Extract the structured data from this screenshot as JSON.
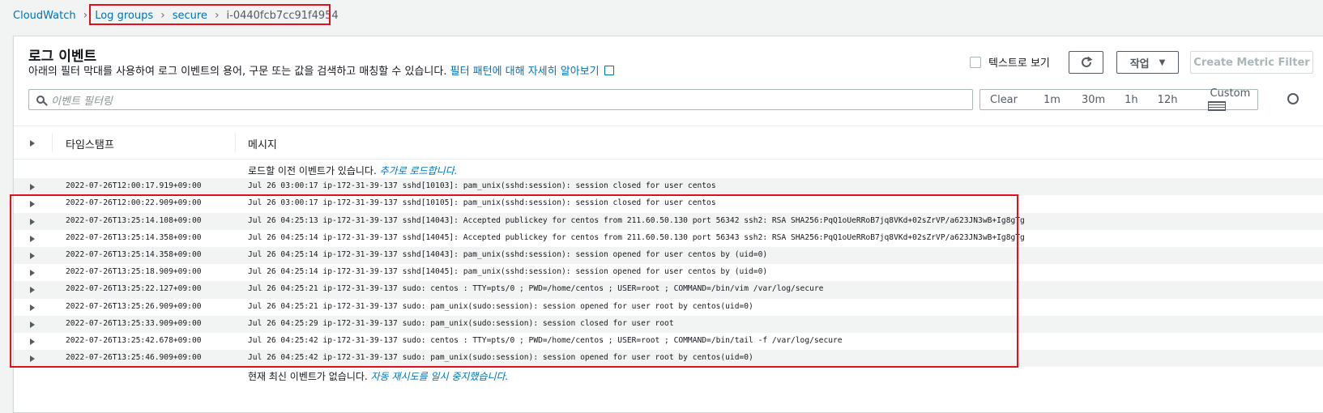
{
  "breadcrumb": {
    "root": "CloudWatch",
    "log_groups": "Log groups",
    "group": "secure",
    "stream": "i-0440fcb7cc91f4954"
  },
  "header": {
    "title": "로그 이벤트",
    "description": "아래의 필터 막대를 사용하여 로그 이벤트의 용어, 구문 또는 값을 검색하고 매칭할 수 있습니다.",
    "learn_more": "필터 패턴에 대해 자세히 알아보기",
    "text_view_label": "텍스트로 보기",
    "action_label": "작업",
    "create_metric_filter": "Create Metric Filter"
  },
  "search": {
    "placeholder": "이벤트 필터링"
  },
  "time_range": {
    "clear": "Clear",
    "m1": "1m",
    "m30": "30m",
    "h1": "1h",
    "h12": "12h",
    "custom": "Custom"
  },
  "table": {
    "col_timestamp": "타임스탬프",
    "col_message": "메시지",
    "load_earlier_text": "로드할 이전 이벤트가 있습니다.",
    "load_more_link": "추가로 로드합니다.",
    "no_newer_text": "현재 최신 이벤트가 없습니다.",
    "auto_retry_link": "자동 재시도를 일시 중지했습니다.",
    "rows": [
      {
        "ts": "2022-07-26T12:00:17.919+09:00",
        "msg": "Jul 26 03:00:17 ip-172-31-39-137 sshd[10103]: pam_unix(sshd:session): session closed for user centos"
      },
      {
        "ts": "2022-07-26T12:00:22.909+09:00",
        "msg": "Jul 26 03:00:17 ip-172-31-39-137 sshd[10105]: pam_unix(sshd:session): session closed for user centos"
      },
      {
        "ts": "2022-07-26T13:25:14.108+09:00",
        "msg": "Jul 26 04:25:13 ip-172-31-39-137 sshd[14043]: Accepted publickey for centos from 211.60.50.130 port 56342 ssh2: RSA SHA256:PqQ1oUeRRoB7jq8VKd+02sZrVP/a623JN3wB+Ig8gTg"
      },
      {
        "ts": "2022-07-26T13:25:14.358+09:00",
        "msg": "Jul 26 04:25:14 ip-172-31-39-137 sshd[14045]: Accepted publickey for centos from 211.60.50.130 port 56343 ssh2: RSA SHA256:PqQ1oUeRRoB7jq8VKd+02sZrVP/a623JN3wB+Ig8gTg"
      },
      {
        "ts": "2022-07-26T13:25:14.358+09:00",
        "msg": "Jul 26 04:25:14 ip-172-31-39-137 sshd[14043]: pam_unix(sshd:session): session opened for user centos by (uid=0)"
      },
      {
        "ts": "2022-07-26T13:25:18.909+09:00",
        "msg": "Jul 26 04:25:14 ip-172-31-39-137 sshd[14045]: pam_unix(sshd:session): session opened for user centos by (uid=0)"
      },
      {
        "ts": "2022-07-26T13:25:22.127+09:00",
        "msg": "Jul 26 04:25:21 ip-172-31-39-137 sudo: centos : TTY=pts/0 ; PWD=/home/centos ; USER=root ; COMMAND=/bin/vim /var/log/secure"
      },
      {
        "ts": "2022-07-26T13:25:26.909+09:00",
        "msg": "Jul 26 04:25:21 ip-172-31-39-137 sudo: pam_unix(sudo:session): session opened for user root by centos(uid=0)"
      },
      {
        "ts": "2022-07-26T13:25:33.909+09:00",
        "msg": "Jul 26 04:25:29 ip-172-31-39-137 sudo: pam_unix(sudo:session): session closed for user root"
      },
      {
        "ts": "2022-07-26T13:25:42.678+09:00",
        "msg": "Jul 26 04:25:42 ip-172-31-39-137 sudo: centos : TTY=pts/0 ; PWD=/home/centos ; USER=root ; COMMAND=/bin/tail -f /var/log/secure"
      },
      {
        "ts": "2022-07-26T13:25:46.909+09:00",
        "msg": "Jul 26 04:25:42 ip-172-31-39-137 sudo: pam_unix(sudo:session): session opened for user root by centos(uid=0)"
      }
    ]
  },
  "colors": {
    "link": "#0073bb",
    "highlight": "#e0101f",
    "stripe": "#f2f3f3"
  }
}
